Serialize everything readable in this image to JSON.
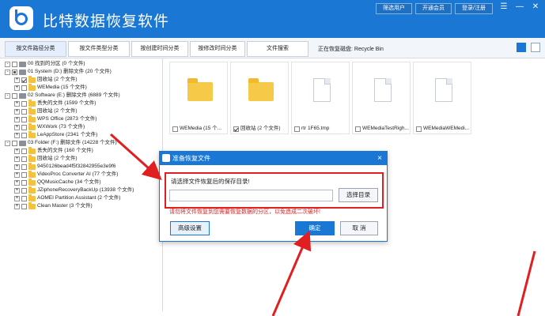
{
  "app": {
    "title": "比特数据恢复软件"
  },
  "top_buttons": [
    "筛选用户",
    "开通会员",
    "登录/注册"
  ],
  "window_controls": [
    "☰",
    "—",
    "✕"
  ],
  "tabs": [
    "按文件路径分类",
    "按文件类型分类",
    "按创建时间分类",
    "按修改时间分类",
    "文件搜索"
  ],
  "recycle_label": "正在恢复磁盘: Recycle Bin",
  "tree": [
    {
      "expander": "-",
      "check": "",
      "icon": "drive",
      "label": "00 找到的分区  (0 个文件)"
    },
    {
      "expander": "-",
      "check": "partial",
      "icon": "drive",
      "label": "01 System (D:) 删除文件  (20 个文件)"
    },
    {
      "expander": "+",
      "check": "checked",
      "icon": "folder",
      "label": "回收站     (2 个文件)"
    },
    {
      "expander": "+",
      "check": "",
      "icon": "folder",
      "label": "WEMedia       (15 个文件)"
    },
    {
      "expander": "-",
      "check": "",
      "icon": "drive",
      "label": "02 Software (E:) 删除文件  (6889 个文件)"
    },
    {
      "expander": "+",
      "check": "",
      "icon": "folder",
      "label": "丢失的文件     (1599 个文件)"
    },
    {
      "expander": "+",
      "check": "",
      "icon": "folder",
      "label": "回收站     (2 个文件)"
    },
    {
      "expander": "+",
      "check": "",
      "icon": "folder",
      "label": "WPS Office     (2873 个文件)"
    },
    {
      "expander": "+",
      "check": "",
      "icon": "folder",
      "label": "WXWork     (73 个文件)"
    },
    {
      "expander": "+",
      "check": "",
      "icon": "folder",
      "label": "LeAppStore     (2341 个文件)"
    },
    {
      "expander": "-",
      "check": "",
      "icon": "drive",
      "label": "03 Folder (F:) 删除文件  (14228 个文件)"
    },
    {
      "expander": "+",
      "check": "",
      "icon": "folder",
      "label": "丢失的文件     (160 个文件)"
    },
    {
      "expander": "+",
      "check": "",
      "icon": "folder",
      "label": "回收站     (2 个文件)"
    },
    {
      "expander": "+",
      "check": "",
      "icon": "folder",
      "label": "9450126bead4f5f32842955e3e9f6"
    },
    {
      "expander": "+",
      "check": "",
      "icon": "folder",
      "label": "VideoProc Converter AI     (77 个文件)"
    },
    {
      "expander": "+",
      "check": "",
      "icon": "folder",
      "label": "QQMusicCache     (34 个文件)"
    },
    {
      "expander": "+",
      "check": "",
      "icon": "folder",
      "label": "JZiphoneRecoveryBackUp     (13938 个文件)"
    },
    {
      "expander": "+",
      "check": "",
      "icon": "folder",
      "label": "AOMEI Partition Assistant     (2 个文件)"
    },
    {
      "expander": "+",
      "check": "",
      "icon": "folder",
      "label": "Clean Master     (3 个文件)"
    }
  ],
  "files": [
    {
      "type": "folder",
      "checked": false,
      "caption": "WEMedia (15 个..."
    },
    {
      "type": "folder",
      "checked": true,
      "caption": "回收站 (2 个文件)"
    },
    {
      "type": "doc",
      "checked": false,
      "caption": "rtr 1F65.tmp"
    },
    {
      "type": "doc",
      "checked": false,
      "caption": "WEMediaTestRigh..."
    },
    {
      "type": "doc",
      "checked": false,
      "caption": "WEMediaWEMedi..."
    }
  ],
  "dialog": {
    "title": "准备恢复文件",
    "close": "×",
    "prompt": "请选择文件恢复后的保存目录!",
    "input_value": "",
    "choose_label": "选择目录",
    "warning": "请勿将文件恢复到您需要恢复数据的分区，以免造成二次破坏!",
    "advanced_label": "高级设置",
    "ok_label": "确定",
    "cancel_label": "取 消"
  },
  "colors": {
    "brand": "#1b77d4",
    "warning": "#e02020",
    "folder": "#f4c23c"
  }
}
